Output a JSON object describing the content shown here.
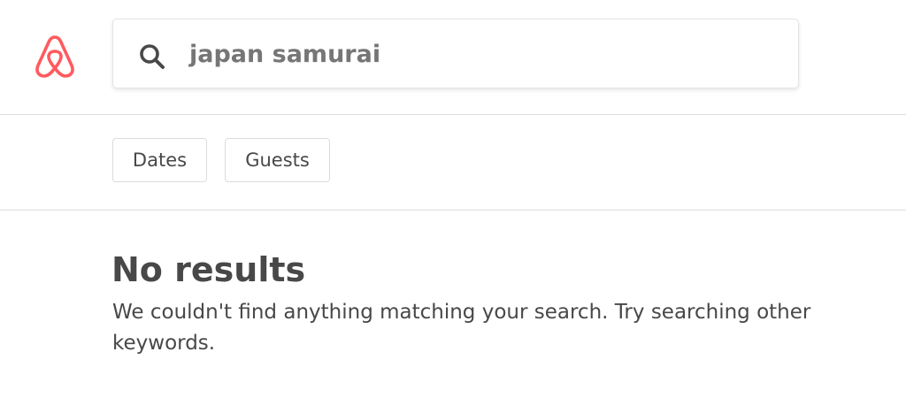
{
  "brand": {
    "logo_icon": "airbnb-belo-icon",
    "accent_color": "#FF5A5F"
  },
  "search": {
    "icon": "search-icon",
    "value": "japan samurai"
  },
  "filters": [
    {
      "label": "Dates"
    },
    {
      "label": "Guests"
    }
  ],
  "results": {
    "title": "No results",
    "message": "We couldn't find anything matching your search. Try searching other keywords."
  }
}
